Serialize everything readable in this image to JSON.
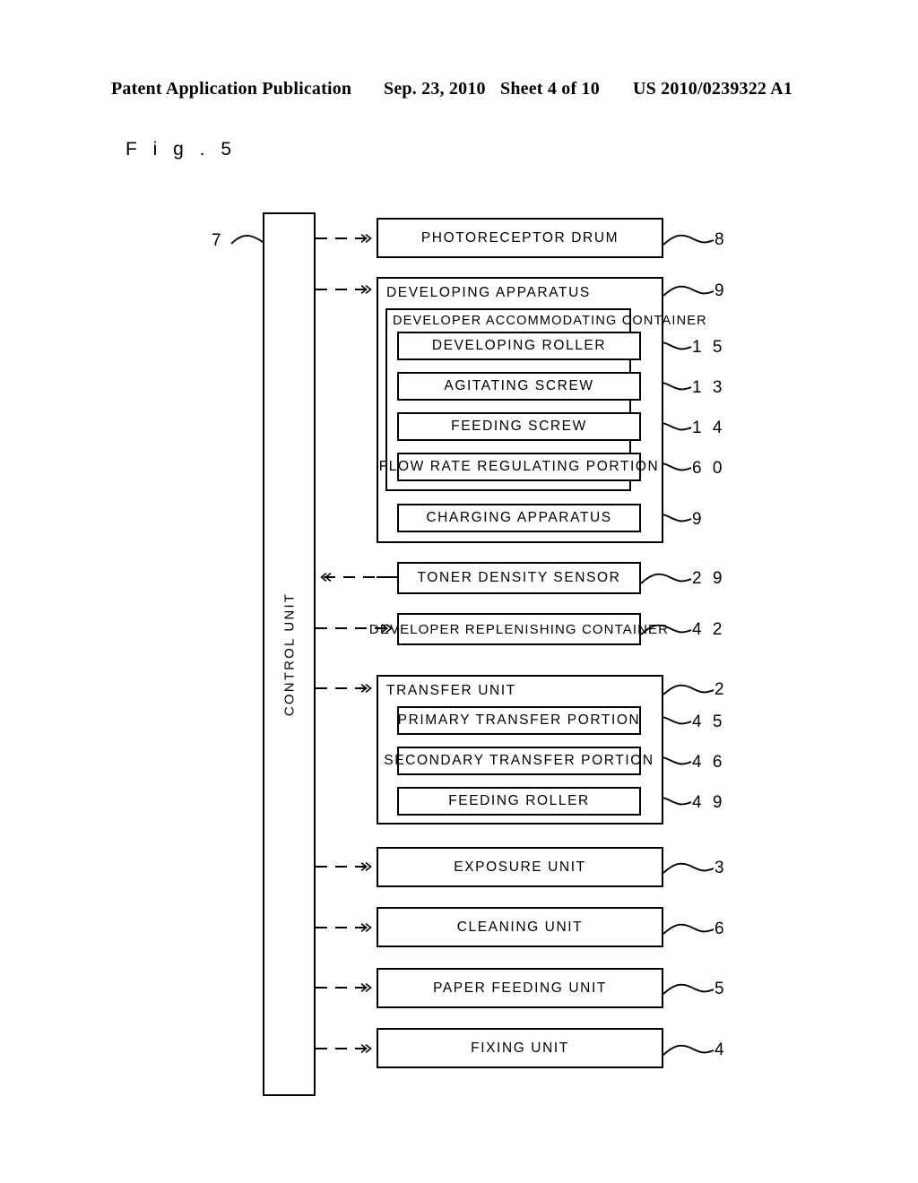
{
  "header": {
    "publication": "Patent Application Publication",
    "date": "Sep. 23, 2010",
    "sheet": "Sheet 4 of 10",
    "patent_number": "US 2010/0239322 A1"
  },
  "figure": {
    "label": "F i g .  5",
    "control_unit": {
      "label": "CONTROL UNIT",
      "ref": "7"
    },
    "blocks": [
      {
        "name": "photoreceptor-drum",
        "label": "PHOTORECEPTOR DRUM",
        "ref": "8",
        "arrow": "right"
      },
      {
        "name": "developing-apparatus",
        "label": "DEVELOPING APPARATUS",
        "ref": "9",
        "arrow": "right"
      },
      {
        "name": "developer-accommodating-container",
        "label": "DEVELOPER ACCOMMODATING CONTAINER",
        "ref": "",
        "arrow": "none"
      },
      {
        "name": "developing-roller",
        "label": "DEVELOPING ROLLER",
        "ref": "1 5",
        "arrow": "none"
      },
      {
        "name": "agitating-screw",
        "label": "AGITATING SCREW",
        "ref": "1 3",
        "arrow": "none"
      },
      {
        "name": "feeding-screw",
        "label": "FEEDING SCREW",
        "ref": "1 4",
        "arrow": "none"
      },
      {
        "name": "flow-rate-regulating-portion",
        "label": "FLOW RATE REGULATING PORTION",
        "ref": "6 0",
        "arrow": "none"
      },
      {
        "name": "charging-apparatus",
        "label": "CHARGING APPARATUS",
        "ref": "9",
        "arrow": "none"
      },
      {
        "name": "toner-density-sensor",
        "label": "TONER DENSITY SENSOR",
        "ref": "2 9",
        "arrow": "left"
      },
      {
        "name": "developer-replenishing-container",
        "label": "DEVELOPER REPLENISHING CONTAINER",
        "ref": "4 2",
        "arrow": "right"
      },
      {
        "name": "transfer-unit",
        "label": "TRANSFER UNIT",
        "ref": "2",
        "arrow": "right"
      },
      {
        "name": "primary-transfer-portion",
        "label": "PRIMARY TRANSFER PORTION",
        "ref": "4 5",
        "arrow": "none"
      },
      {
        "name": "secondary-transfer-portion",
        "label": "SECONDARY TRANSFER PORTION",
        "ref": "4 6",
        "arrow": "none"
      },
      {
        "name": "feeding-roller",
        "label": "FEEDING ROLLER",
        "ref": "4 9",
        "arrow": "none"
      },
      {
        "name": "exposure-unit",
        "label": "EXPOSURE UNIT",
        "ref": "3",
        "arrow": "right"
      },
      {
        "name": "cleaning-unit",
        "label": "CLEANING UNIT",
        "ref": "6",
        "arrow": "right"
      },
      {
        "name": "paper-feeding-unit",
        "label": "PAPER FEEDING UNIT",
        "ref": "5",
        "arrow": "right"
      },
      {
        "name": "fixing-unit",
        "label": "FIXING UNIT",
        "ref": "4",
        "arrow": "right"
      }
    ]
  }
}
